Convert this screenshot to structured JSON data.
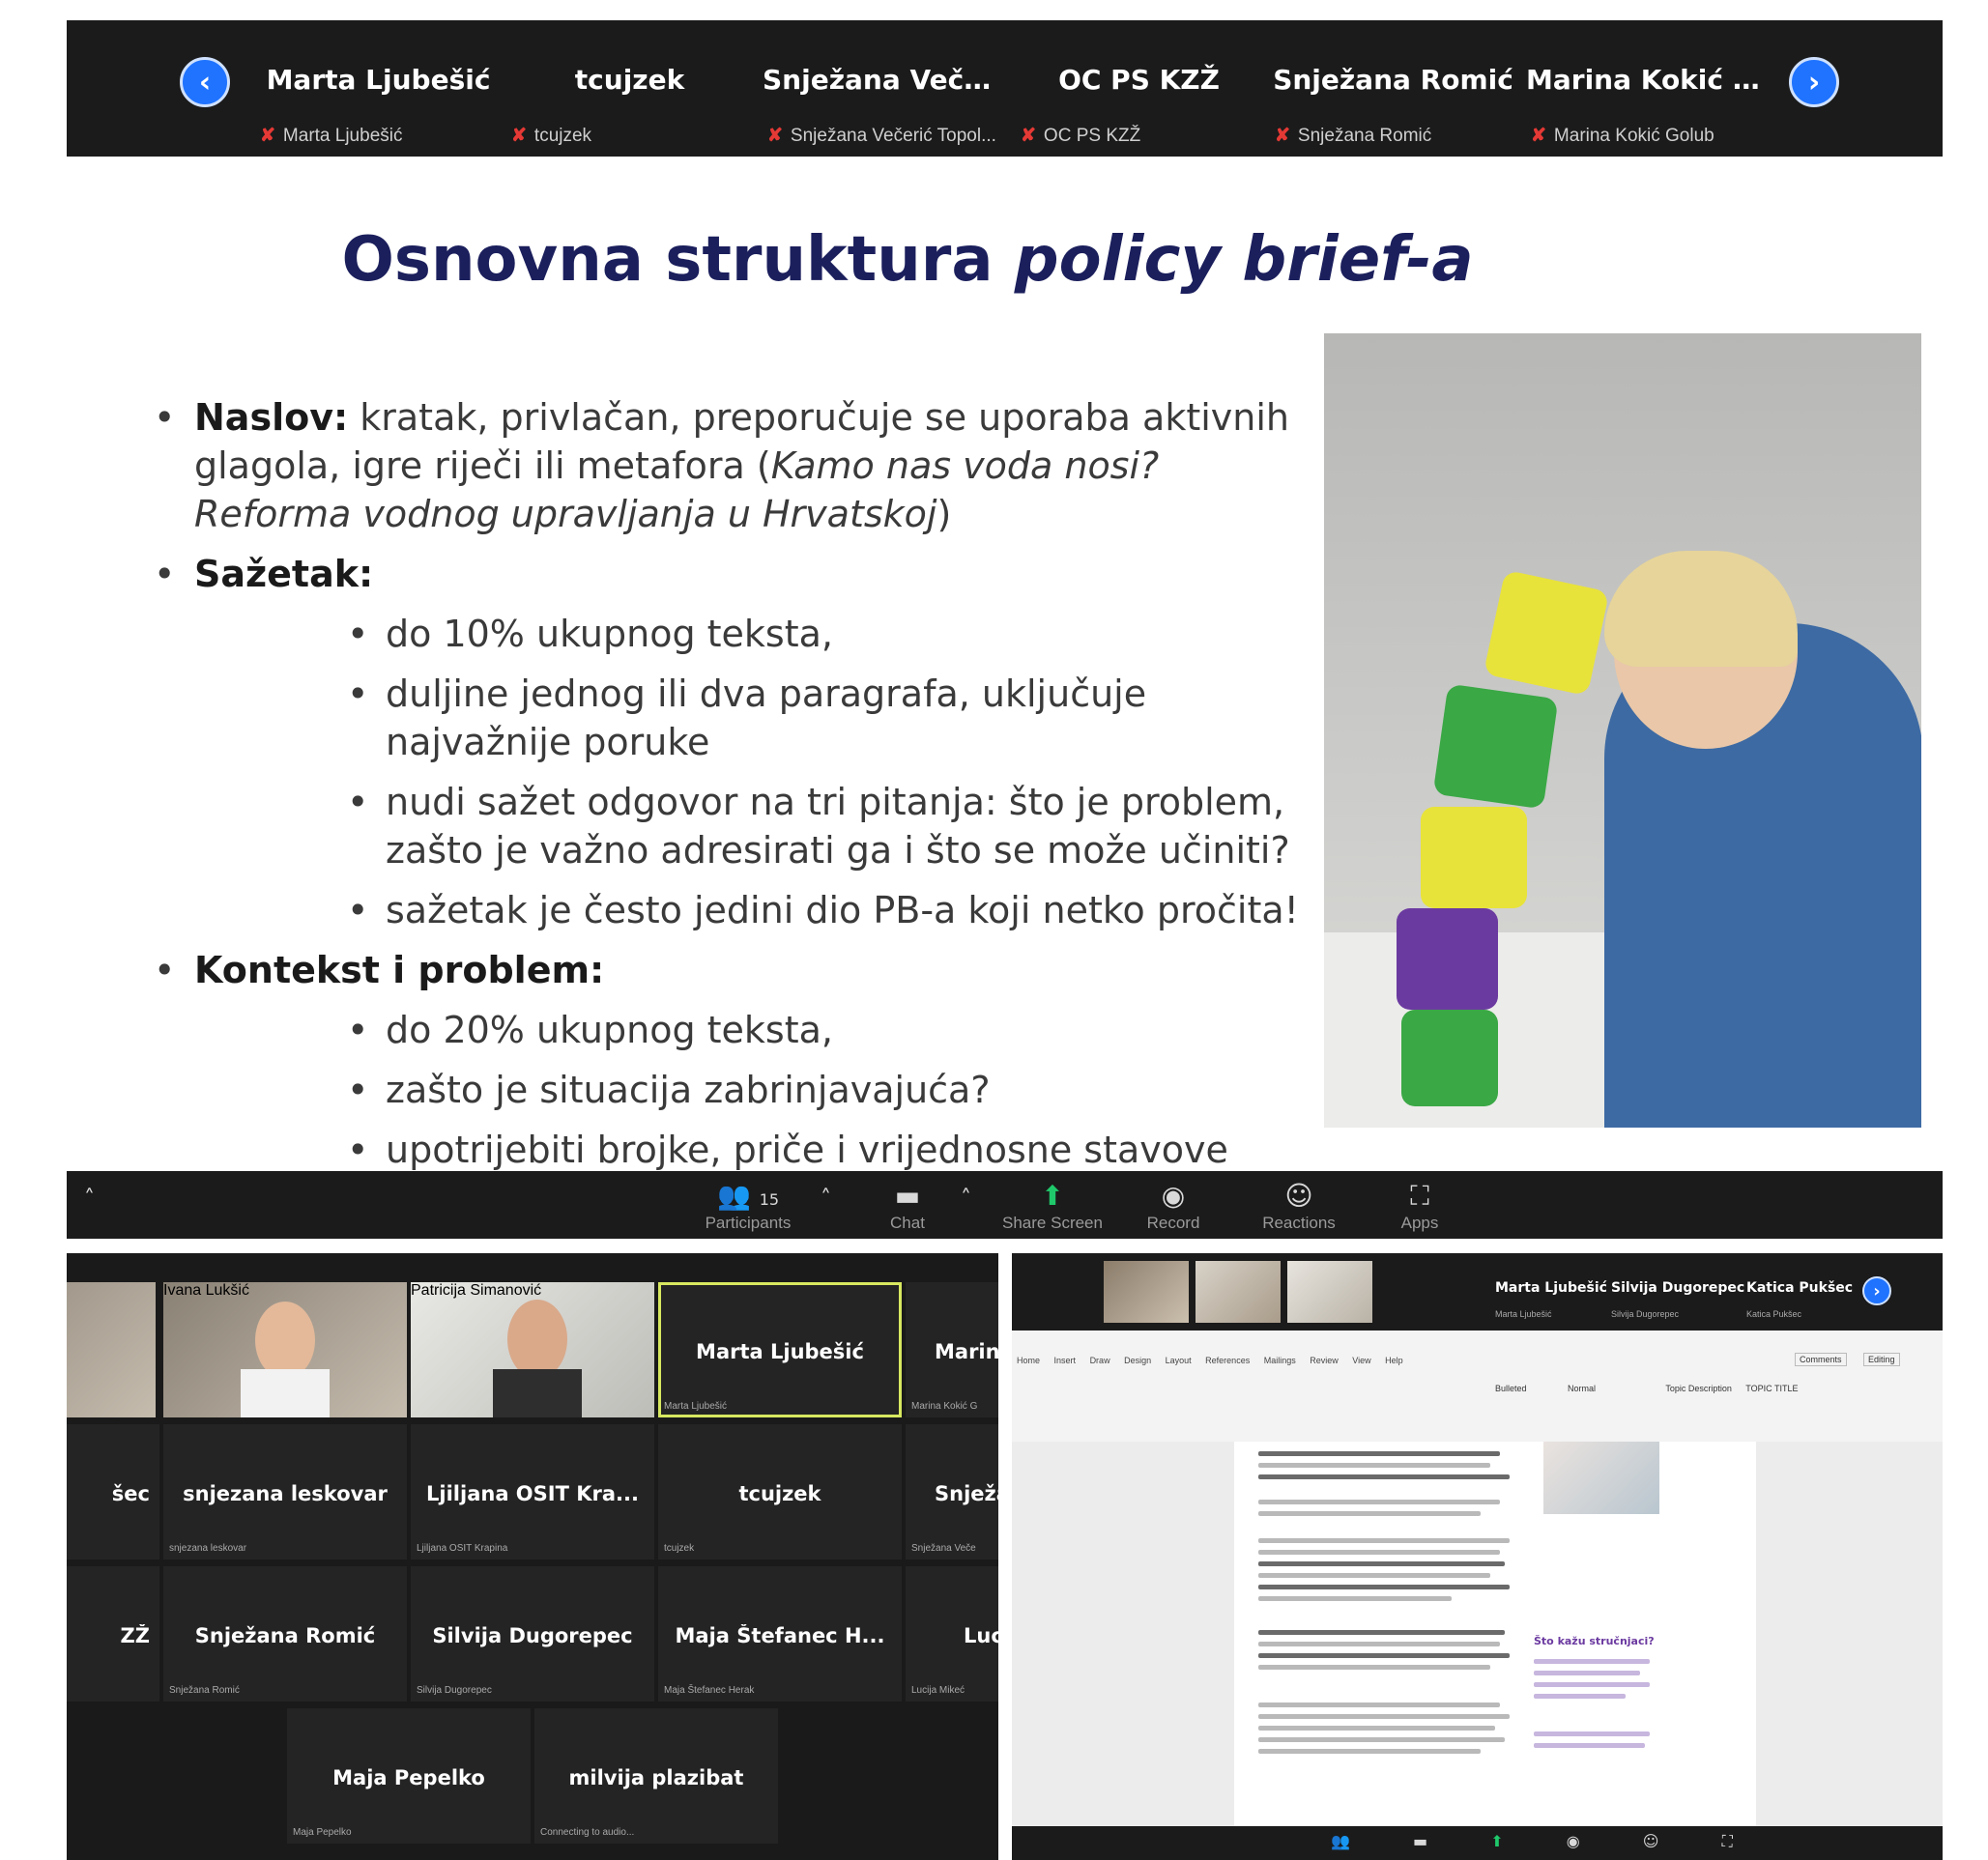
{
  "top_strip": {
    "participants": [
      {
        "name": "Marta Ljubešić",
        "sub": "Marta Ljubešić"
      },
      {
        "name": "tcujzek",
        "sub": "tcujzek"
      },
      {
        "name": "Snježana Večeri...",
        "sub": "Snježana Večerić Topol..."
      },
      {
        "name": "OC PS KZŽ",
        "sub": "OC PS KZŽ"
      },
      {
        "name": "Snježana Romić",
        "sub": "Snježana Romić"
      },
      {
        "name": "Marina Kokić G...",
        "sub": "Marina Kokić Golub"
      }
    ],
    "prev_icon": "chevron-left-icon",
    "next_icon": "chevron-right-icon"
  },
  "slide": {
    "title_regular": "Osnovna struktura ",
    "title_italic": "policy brief-a",
    "naslov_label": "Naslov:",
    "naslov_text": " kratak, privlačan, preporučuje se uporaba aktivnih glagola, igre riječi ili metafora (",
    "naslov_italic": "Kamo nas voda nosi? Reforma vodnog upravljanja u Hrvatskoj",
    "naslov_end": ")",
    "sazetak_label": "Sažetak:",
    "sazetak_items": [
      "do 10% ukupnog teksta,",
      "duljine jednog ili dva paragrafa, uključuje najvažnije poruke",
      "nudi sažet odgovor na tri pitanja: što je problem, zašto je važno adresirati ga i što se može učiniti?",
      "sažetak je često jedini dio PB-a koji netko pročita!"
    ],
    "kontekst_label": "Kontekst i problem:",
    "kontekst_items": [
      "do 20% ukupnog teksta,",
      "zašto je situacija zabrinjavajuća?",
      "upotrijebiti brojke, priče i vrijednosne stavove"
    ]
  },
  "toolbar": {
    "participants_count": "15",
    "participants_label": "Participants",
    "chat_label": "Chat",
    "share_label": "Share Screen",
    "record_label": "Record",
    "reactions_label": "Reactions",
    "apps_label": "Apps",
    "accent_green": "#1fc96b"
  },
  "gallery": {
    "row1": [
      {
        "name": "",
        "sub": "Ivana Lukšić"
      },
      {
        "name": "",
        "sub": "Patricija Simanović"
      },
      {
        "name": "Marta Ljubešić",
        "sub": "Marta Ljubešić"
      },
      {
        "name": "Marin",
        "sub": "Marina Kokić G"
      }
    ],
    "row2": [
      {
        "name": "šec",
        "sub": ""
      },
      {
        "name": "snjezana leskovar",
        "sub": "snjezana leskovar"
      },
      {
        "name": "Ljiljana OSIT Kra...",
        "sub": "Ljiljana OSIT Krapina"
      },
      {
        "name": "tcujzek",
        "sub": "tcujzek"
      },
      {
        "name": "Snježa",
        "sub": "Snježana Veče"
      }
    ],
    "row3": [
      {
        "name": "ZŽ",
        "sub": ""
      },
      {
        "name": "Snježana Romić",
        "sub": "Snježana Romić"
      },
      {
        "name": "Silvija Dugorepec",
        "sub": "Silvija Dugorepec"
      },
      {
        "name": "Maja Štefanec H...",
        "sub": "Maja Štefanec Herak"
      },
      {
        "name": "Luc",
        "sub": "Lucija Mikeć"
      }
    ],
    "row4": [
      {
        "name": "Maja Pepelko",
        "sub": "Maja Pepelko"
      },
      {
        "name": "milvija plazibat",
        "sub": "Connecting to audio..."
      }
    ]
  },
  "share": {
    "strip_names": [
      "Marta Ljubešić",
      "Silvija Dugorepec",
      "Katica Pukšec"
    ],
    "strip_subs": [
      "Marta Ljubešić",
      "Silvija Dugorepec",
      "Katica Pukšec"
    ],
    "ribbon_tabs": [
      "Home",
      "Insert",
      "Draw",
      "Design",
      "Layout",
      "References",
      "Mailings",
      "Review",
      "View",
      "Help"
    ],
    "style_names": [
      "Bulleted",
      "Normal",
      "Topic Description",
      "TOPIC TITLE"
    ],
    "right_buttons": [
      "Comments",
      "Editing"
    ],
    "side_heading": "Što kažu stručnjaci?"
  }
}
